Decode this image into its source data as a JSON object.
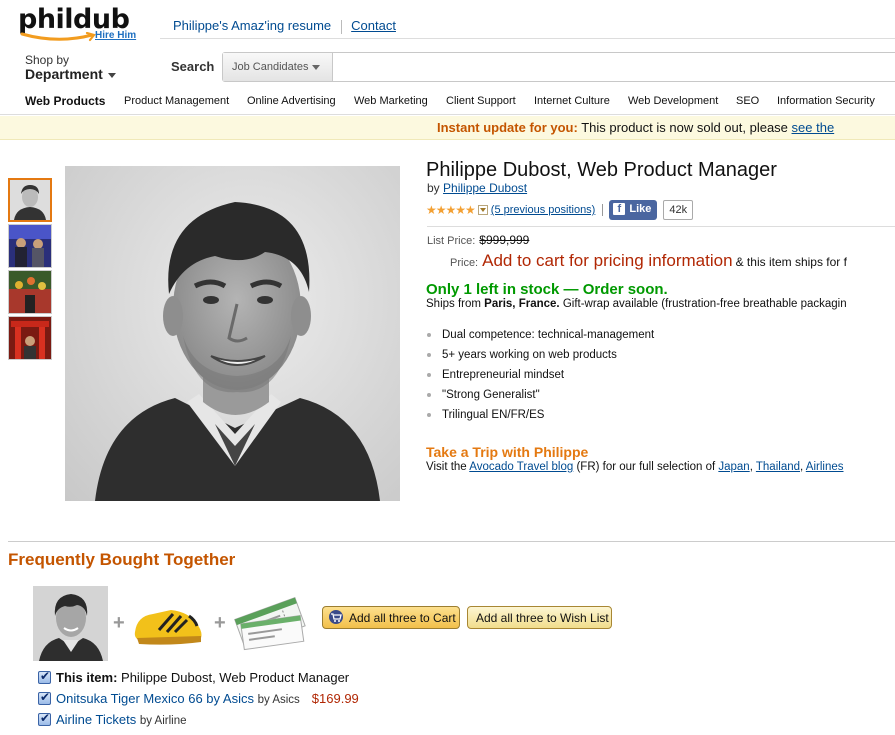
{
  "header": {
    "logo": "phildub",
    "logo_sub": "Hire Him",
    "link_resume": "Philippe's Amaz'ing resume",
    "link_contact": "Contact",
    "shop_by_1": "Shop by",
    "shop_by_2": "Department",
    "search_label": "Search",
    "search_category": "Job Candidates",
    "search_value": ""
  },
  "nav": {
    "items": [
      "Web Products",
      "Product Management",
      "Online Advertising",
      "Web Marketing",
      "Client Support",
      "Internet Culture",
      "Web Development",
      "SEO",
      "Information Security"
    ]
  },
  "banner": {
    "title": "Instant update for you:",
    "text": "This product is now sold out, please",
    "link": "see the"
  },
  "product": {
    "title": "Philippe Dubost, Web Product Manager",
    "by_label": "by",
    "author": "Philippe Dubost",
    "stars": "★★★★★",
    "rating": 5,
    "reviews": "(5 previous positions)",
    "like_label": "Like",
    "like_count": "42k",
    "list_price_label": "List Price:",
    "list_price": "$999,999",
    "price_label": "Price:",
    "price_text": "Add to cart for pricing information",
    "price_rest": "& this item ships for f",
    "stock": "Only 1 left in stock — Order soon.",
    "ships_a": "Ships from",
    "ships_from": "Paris, France.",
    "ships_b": "Gift-wrap available (frustration-free breathable packagin",
    "bullets": [
      "Dual competence: technical-management",
      "5+ years working on web products",
      "Entrepreneurial mindset",
      "\"Strong Generalist\"",
      "Trilingual EN/FR/ES"
    ],
    "trip_title": "Take a Trip with Philippe",
    "trip_a": "Visit the",
    "trip_link": "Avocado Travel blog",
    "trip_b": "(FR) for our full selection of",
    "trip_japan": "Japan",
    "trip_thailand": "Thailand",
    "trip_airlines": "Airlines"
  },
  "fbt": {
    "title": "Frequently Bought Together",
    "add_cart": "Add all three to Cart",
    "add_wish": "Add all three to Wish List",
    "item1_label": "This item:",
    "item1": "Philippe Dubost, Web Product Manager",
    "item2": "Onitsuka Tiger Mexico 66 by Asics",
    "item2_by": "by Asics",
    "item2_price": "$169.99",
    "item3": "Airline Tickets",
    "item3_by": "by Airline"
  },
  "colors": {
    "accent_orange": "#e47911",
    "price_red": "#b12704",
    "stock_green": "#009900",
    "link_blue": "#004b91"
  }
}
